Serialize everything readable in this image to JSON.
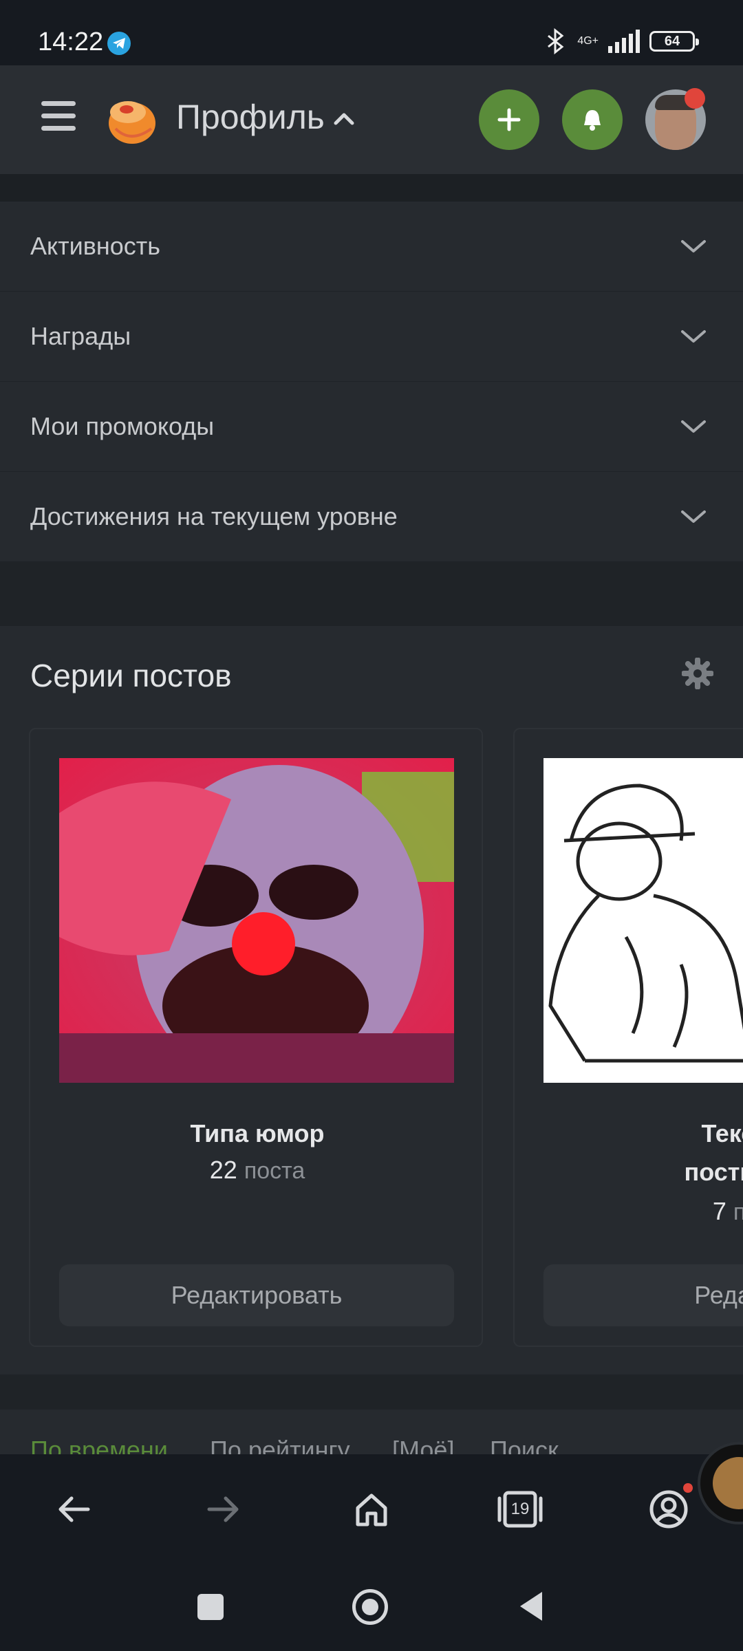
{
  "status_bar": {
    "time": "14:22",
    "network": "4G+",
    "battery": "64"
  },
  "header": {
    "title": "Профиль"
  },
  "accordion": [
    {
      "label": "Активность"
    },
    {
      "label": "Награды"
    },
    {
      "label": "Мои промокоды"
    },
    {
      "label": "Достижения на текущем уровне"
    }
  ],
  "series": {
    "title": "Серии постов",
    "cards": [
      {
        "title": "Типа юмор",
        "count": "22",
        "unit": "поста",
        "button": "Редактировать"
      },
      {
        "title": "Тексто\nпосты(ду",
        "count": "7",
        "unit": "пос",
        "button": "Редакти"
      }
    ]
  },
  "tabs": [
    "По времени",
    "По рейтингу",
    "[Моё]",
    "Поиск"
  ],
  "browser": {
    "tab_count": "19"
  },
  "colors": {
    "accent_green": "#5a8c3a",
    "notification_red": "#e0453b",
    "background": "#1f2327"
  }
}
